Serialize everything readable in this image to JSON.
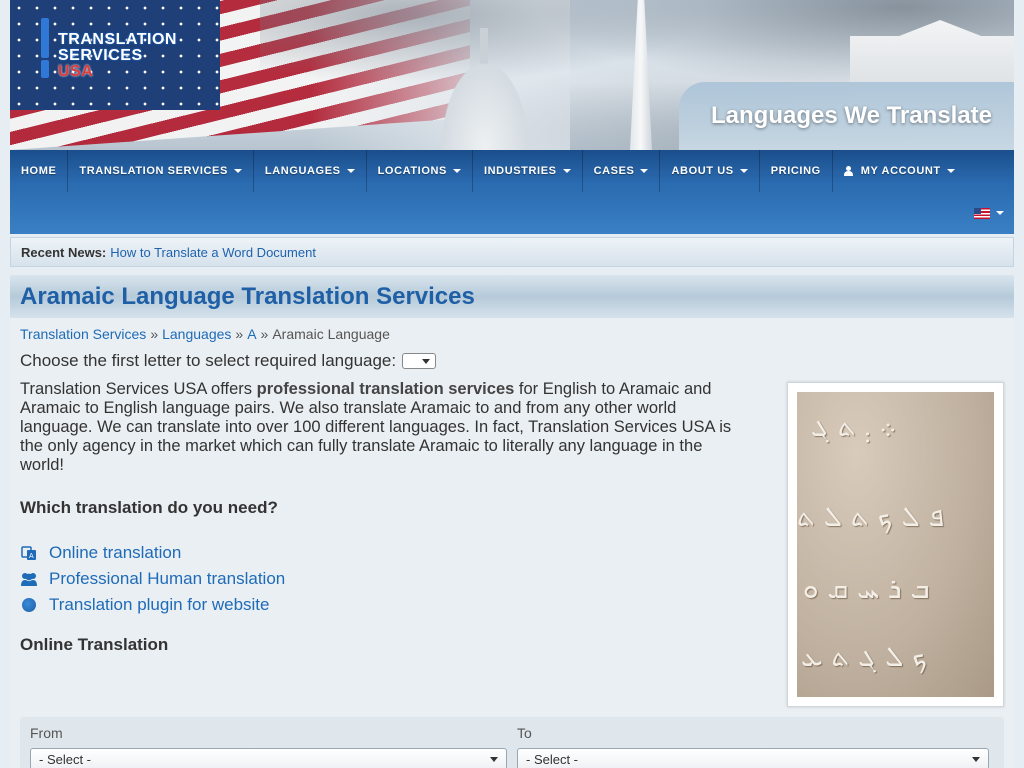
{
  "brand": {
    "logo_line1": "TRANSLATION",
    "logo_line2": "SERVICES",
    "logo_line3": "USA"
  },
  "banner": {
    "tab_title": "Languages We Translate"
  },
  "nav": {
    "items": [
      {
        "label": "HOME",
        "dropdown": false
      },
      {
        "label": "TRANSLATION SERVICES",
        "dropdown": true
      },
      {
        "label": "LANGUAGES",
        "dropdown": true
      },
      {
        "label": "LOCATIONS",
        "dropdown": true
      },
      {
        "label": "INDUSTRIES",
        "dropdown": true
      },
      {
        "label": "CASES",
        "dropdown": true
      },
      {
        "label": "ABOUT US",
        "dropdown": true
      },
      {
        "label": "PRICING",
        "dropdown": false
      },
      {
        "label": "MY ACCOUNT",
        "dropdown": true
      }
    ],
    "language_icon": "us-flag-icon"
  },
  "news": {
    "label": "Recent News:",
    "link": "How to Translate a Word Document"
  },
  "page": {
    "title": "Aramaic Language Translation Services",
    "breadcrumb": [
      "Translation Services",
      "Languages",
      "A",
      "Aramaic Language"
    ],
    "breadcrumb_sep": "»",
    "choose_letter": "Choose the first letter to select required language:",
    "intro_pre": "Translation Services USA offers ",
    "intro_bold": "professional translation services",
    "intro_post": " for English to Aramaic and Aramaic to English language pairs. We also translate Aramaic to and from any other world language. We can translate into over 100 different languages. In fact, Translation Services USA is the only agency in the market which can fully translate Aramaic to literally any language in the world!",
    "question": "Which translation do you need?",
    "options": [
      {
        "label": "Online translation",
        "icon": "translate-icon"
      },
      {
        "label": "Professional Human translation",
        "icon": "users-icon"
      },
      {
        "label": "Translation plugin for website",
        "icon": "globe-icon"
      }
    ],
    "online_title": "Online Translation"
  },
  "translator": {
    "from_label": "From",
    "to_label": "To",
    "from_value": "- Select -",
    "to_value": "- Select -"
  },
  "image": {
    "glyph_rows": [
      "܀ ܄ ܬ ܓ",
      "ܦ ܠ ܟ ܬ ܠ ܬ",
      "ܒ ܪ ܚ ܩ ܘ",
      "ܟ ܠ ܓ ܬ ܥ"
    ]
  },
  "colors": {
    "nav_bg": "#2b6bb0",
    "link": "#1e6bb8",
    "title": "#1e5fa6"
  }
}
